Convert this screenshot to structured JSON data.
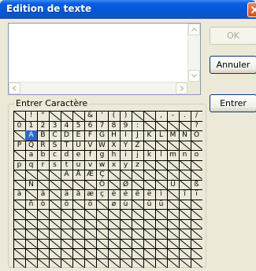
{
  "window": {
    "title": "Edition de texte"
  },
  "editor": {
    "value": ""
  },
  "buttons": {
    "ok": "OK",
    "annuler": "Annuler",
    "entrer": "Entrer"
  },
  "group": {
    "label": "Entrer Caractère"
  },
  "grid": {
    "columns": 16,
    "rows": 16,
    "selected": {
      "row": 2,
      "col": 1
    },
    "cells": [
      [
        "",
        "!",
        "\"",
        "",
        "",
        "",
        "&",
        "'",
        "(",
        ")",
        "",
        "",
        ",",
        "-",
        ".",
        "/"
      ],
      [
        "0",
        "1",
        "2",
        "3",
        "4",
        "5",
        "6",
        "7",
        "8",
        "9",
        ":",
        "",
        "",
        "",
        "",
        "?"
      ],
      [
        "",
        "A",
        "B",
        "C",
        "D",
        "E",
        "F",
        "G",
        "H",
        "I",
        "J",
        "K",
        "L",
        "M",
        "N",
        "O"
      ],
      [
        "P",
        "Q",
        "R",
        "S",
        "T",
        "U",
        "V",
        "W",
        "X",
        "Y",
        "Z",
        "",
        "",
        "",
        "",
        ""
      ],
      [
        "",
        "a",
        "b",
        "c",
        "d",
        "e",
        "f",
        "g",
        "h",
        "i",
        "j",
        "k",
        "l",
        "m",
        "n",
        "o"
      ],
      [
        "p",
        "q",
        "r",
        "s",
        "t",
        "u",
        "v",
        "w",
        "x",
        "y",
        "z",
        "",
        "",
        "",
        "",
        ""
      ],
      [
        "",
        "",
        "",
        "",
        "Ä",
        "Å",
        "Æ",
        "Ç",
        "",
        "",
        "",
        "",
        "",
        "",
        "",
        ""
      ],
      [
        "",
        "Ñ",
        "",
        "",
        "",
        "",
        "",
        "Ö",
        "",
        "Ø",
        "",
        "",
        "",
        "Ü",
        "",
        "ß"
      ],
      [
        "à",
        "",
        "â",
        "",
        "ä",
        "å",
        "æ",
        "ç",
        "è",
        "é",
        "ê",
        "ë",
        "ì",
        "",
        "î",
        "ï"
      ],
      [
        "",
        "ñ",
        "ò",
        "",
        "ô",
        "",
        "ö",
        "",
        "ø",
        "ù",
        "",
        "û",
        "ü",
        "",
        "",
        ""
      ],
      [
        "",
        "",
        "",
        "",
        "",
        "",
        "",
        "",
        "",
        "",
        "",
        "",
        "",
        "",
        "",
        ""
      ],
      [
        "",
        "",
        "",
        "",
        "",
        "",
        "",
        "",
        "",
        "",
        "",
        "",
        "",
        "",
        "",
        ""
      ],
      [
        "",
        "",
        "",
        "",
        "",
        "",
        "",
        "",
        "",
        "",
        "",
        "",
        "",
        "",
        "",
        ""
      ],
      [
        "",
        "",
        "",
        "",
        "",
        "",
        "",
        "",
        "",
        "",
        "",
        "",
        "",
        "",
        "",
        ""
      ],
      [
        "",
        "",
        "",
        "",
        "",
        "",
        "",
        "",
        "",
        "",
        "",
        "",
        "",
        "",
        "",
        ""
      ],
      [
        "",
        "",
        "",
        "",
        "",
        "",
        "",
        "",
        "",
        "",
        "",
        "",
        "",
        "",
        "",
        ""
      ]
    ]
  }
}
